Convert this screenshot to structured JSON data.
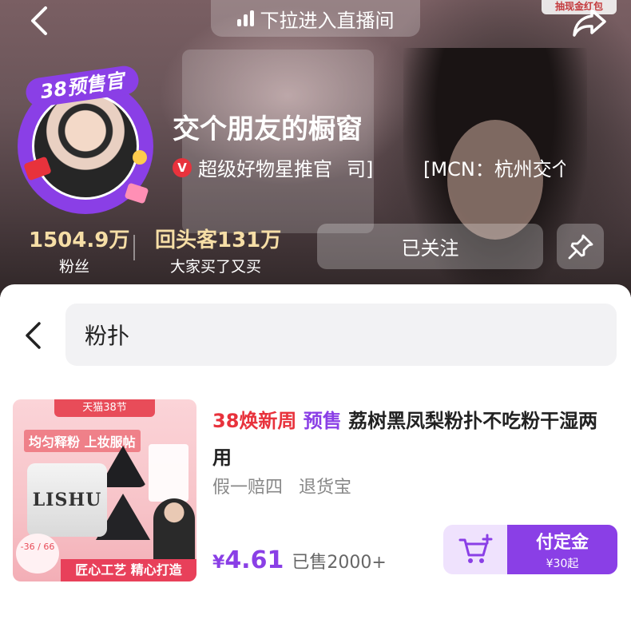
{
  "header": {
    "pull_live_label": "下拉进入直播间",
    "top_badge": "抽现金红包"
  },
  "shop": {
    "avatar_tag": "38预售官",
    "name": "交个朋友的橱窗",
    "verify_badge": "V",
    "verify_text": "超级好物星推官",
    "verify_tail": "司]",
    "mcn": "[MCN：杭州交个",
    "follow_label": "已关注"
  },
  "stats": {
    "fans_value": "1504.9万",
    "fans_label": "粉丝",
    "repeat_value": "回头客131万",
    "repeat_label": "大家买了又买"
  },
  "search": {
    "query": "粉扑"
  },
  "product": {
    "image": {
      "top_strip": "天猫38节",
      "slogan": "均匀释粉 上妆服帖",
      "brand": "LISHU",
      "price_burst": "-36 / 66",
      "bottom_strip": "匠心工艺 精心打造"
    },
    "title_tag_event": "38焕新周",
    "title_tag_presale": "预售",
    "title": "荔树黑凤梨粉扑不吃粉干湿两用",
    "tags": [
      "假一赔四",
      "退货宝"
    ],
    "price_symbol": "¥",
    "price": "4.61",
    "sold": "已售2000+",
    "deposit_label": "付定金",
    "deposit_sub": "¥30起"
  },
  "colors": {
    "accent": "#8a3fe6",
    "event_red": "#e8323c",
    "stat_gold": "#f6dea6"
  },
  "icons": {
    "back": "chevron-left-icon",
    "share": "share-arrow-icon",
    "pin": "pin-icon",
    "cart": "cart-plus-icon",
    "live": "signal-bars-icon"
  }
}
